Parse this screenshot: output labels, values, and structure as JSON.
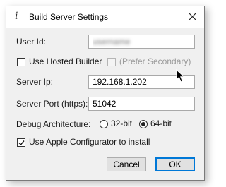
{
  "window": {
    "icon_glyph": "i",
    "title": "Build Server Settings",
    "close_icon": "close-icon"
  },
  "form": {
    "user_id": {
      "label": "User Id:",
      "value": "username"
    },
    "use_hosted_builder": {
      "label": "Use Hosted Builder",
      "checked": false
    },
    "prefer_secondary": {
      "label": "(Prefer Secondary)",
      "checked": false,
      "enabled": false
    },
    "server_ip": {
      "label": "Server Ip:",
      "value": "192.168.1.202"
    },
    "server_port": {
      "label": "Server Port (https):",
      "value": "51042"
    },
    "debug_arch": {
      "label": "Debug Architecture:",
      "options": [
        {
          "label": "32-bit",
          "selected": false
        },
        {
          "label": "64-bit",
          "selected": true
        }
      ]
    },
    "apple_configurator": {
      "label": "Use Apple Configurator to install",
      "checked": true
    }
  },
  "buttons": {
    "cancel": "Cancel",
    "ok": "OK"
  },
  "colors": {
    "accent": "#0078d7",
    "dialog_bg": "#f0f0f0"
  }
}
